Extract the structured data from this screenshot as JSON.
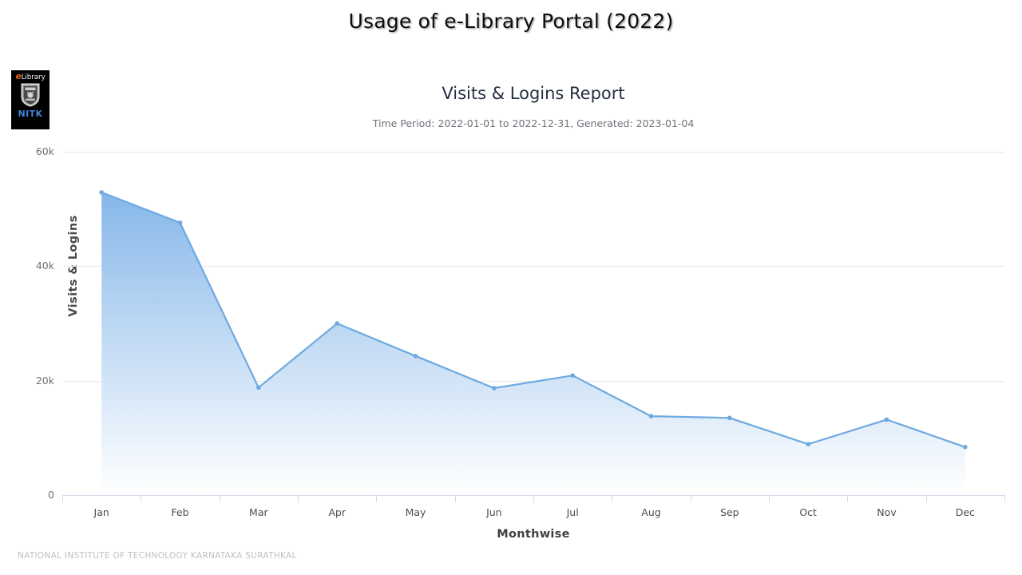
{
  "page": {
    "title": "Usage of e-Library Portal (2022)",
    "footer": "NATIONAL INSTITUTE OF TECHNOLOGY KARNATAKA SURATHKAL"
  },
  "logo": {
    "name": "elibrary-nitk-logo",
    "word_e": "e",
    "word_library": "Library",
    "institute_short": "NITK",
    "colors": {
      "background": "#000000",
      "accent_e": "#e8601c",
      "word": "#f2f2f2",
      "institute": "#3d86d8"
    }
  },
  "chart_data": {
    "type": "area",
    "title": "Visits & Logins Report",
    "subtitle": "Time Period: 2022-01-01 to 2022-12-31, Generated: 2023-01-04",
    "xlabel": "Monthwise",
    "ylabel": "Visits & Logins",
    "categories": [
      "Jan",
      "Feb",
      "Mar",
      "Apr",
      "May",
      "Jun",
      "Jul",
      "Aug",
      "Sep",
      "Oct",
      "Nov",
      "Dec"
    ],
    "values": [
      52900,
      47600,
      18800,
      30000,
      24300,
      18700,
      20900,
      13800,
      13500,
      8900,
      13200,
      8400
    ],
    "series": [
      {
        "name": "Visits & Logins",
        "values": [
          52900,
          47600,
          18800,
          30000,
          24300,
          18700,
          20900,
          13800,
          13500,
          8900,
          13200,
          8400
        ]
      }
    ],
    "ylim": [
      0,
      60000
    ],
    "ytick_values": [
      0,
      20000,
      40000,
      60000
    ],
    "ytick_labels": [
      "0",
      "20k",
      "40k",
      "60k"
    ],
    "grid": true,
    "legend": "none",
    "marker": "circle",
    "colors": {
      "line": "#6ea9e0",
      "fill_top": "#7fb3e8",
      "fill_bottom": "#ffffff",
      "marker": "#6ea9e0",
      "gridline": "#e8e8e8",
      "axis": "#d6dbeb"
    }
  }
}
